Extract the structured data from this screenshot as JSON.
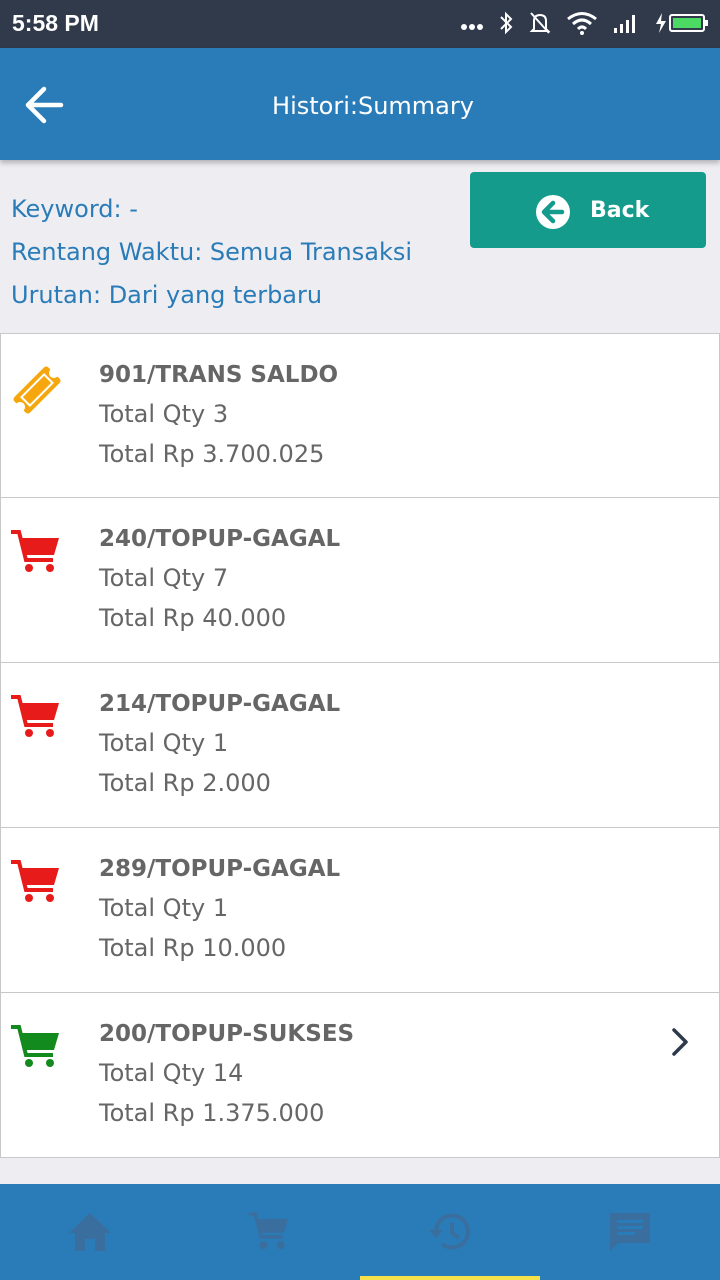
{
  "status_bar": {
    "time": "5:58 PM"
  },
  "app_bar": {
    "title": "Histori:Summary"
  },
  "filter": {
    "keyword": "Keyword: -",
    "range": "Rentang Waktu: Semua Transaksi",
    "order": "Urutan: Dari yang terbaru"
  },
  "back_button": {
    "label": "Back"
  },
  "items": [
    {
      "title": "901/TRANS SALDO",
      "qty": "Total Qty 3",
      "amount": "Total Rp 3.700.025",
      "icon": "ticket-icon",
      "icon_color": "#f5a70d"
    },
    {
      "title": "240/TOPUP-GAGAL",
      "qty": "Total Qty 7",
      "amount": "Total Rp 40.000",
      "icon": "cart-icon",
      "icon_color": "#e81b1b"
    },
    {
      "title": "214/TOPUP-GAGAL",
      "qty": "Total Qty 1",
      "amount": "Total Rp 2.000",
      "icon": "cart-icon",
      "icon_color": "#e81b1b"
    },
    {
      "title": "289/TOPUP-GAGAL",
      "qty": "Total Qty 1",
      "amount": "Total Rp 10.000",
      "icon": "cart-icon",
      "icon_color": "#e81b1b"
    },
    {
      "title": "200/TOPUP-SUKSES",
      "qty": "Total Qty 14",
      "amount": "Total Rp 1.375.000",
      "icon": "cart-icon",
      "icon_color": "#138a1e"
    }
  ],
  "bottom_nav": [
    {
      "icon": "home-icon"
    },
    {
      "icon": "cart-icon"
    },
    {
      "icon": "history-icon",
      "active": true
    },
    {
      "icon": "chat-icon"
    }
  ],
  "colors": {
    "primary": "#2a7cb8",
    "back_button": "#149b8c",
    "status_bar": "#303a4a",
    "nav_indicator": "#f5e14a",
    "nav_icon": "#3a6e9e"
  }
}
